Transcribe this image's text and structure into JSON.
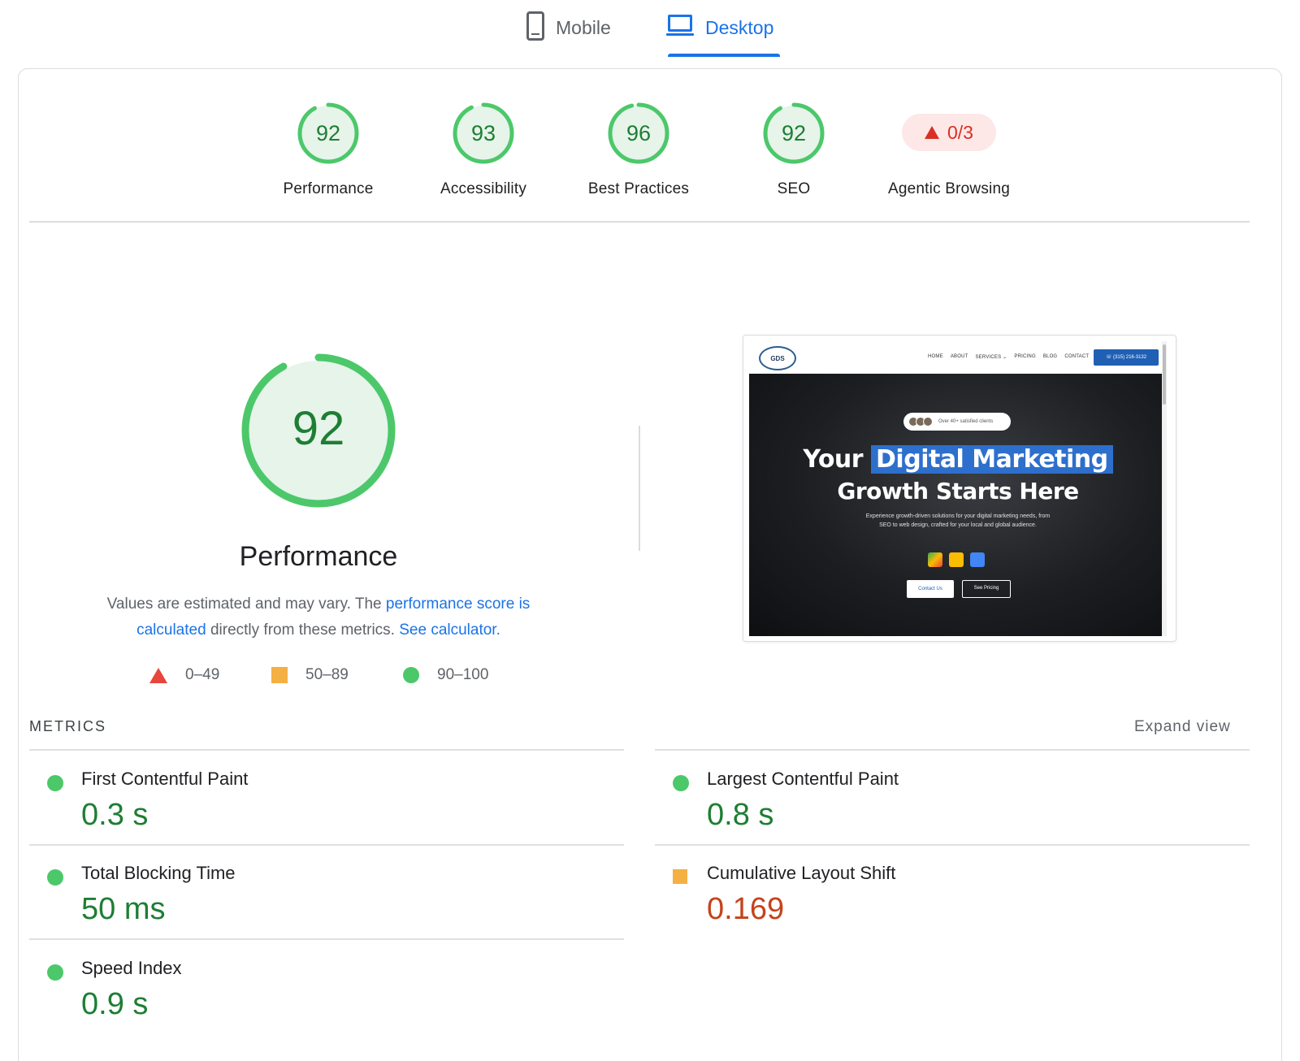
{
  "tabs": [
    {
      "label": "Mobile",
      "icon": "phone-icon",
      "active": false
    },
    {
      "label": "Desktop",
      "icon": "laptop-icon",
      "active": true
    }
  ],
  "categories": [
    {
      "score": "92",
      "label": "Performance"
    },
    {
      "score": "93",
      "label": "Accessibility"
    },
    {
      "score": "96",
      "label": "Best Practices"
    },
    {
      "score": "92",
      "label": "SEO"
    },
    {
      "score": "0/3",
      "label": "Agentic Browsing"
    }
  ],
  "performance": {
    "score": "92",
    "score_value": 92,
    "title": "Performance",
    "desc_part1": "Values are estimated and may vary. The ",
    "desc_link1": "performance score is calculated",
    "desc_part2": " directly from these metrics. ",
    "desc_link2": "See calculator."
  },
  "legend": [
    {
      "range": "0–49",
      "shape": "triangle",
      "color": "#e8453c"
    },
    {
      "range": "50–89",
      "shape": "square",
      "color": "#f4b042"
    },
    {
      "range": "90–100",
      "shape": "circle",
      "color": "#4cc86a"
    }
  ],
  "metrics_header": "METRICS",
  "expand_label": "Expand view",
  "metrics": [
    {
      "name": "First Contentful Paint",
      "value": "0.3 s",
      "status": "good"
    },
    {
      "name": "Largest Contentful Paint",
      "value": "0.8 s",
      "status": "good"
    },
    {
      "name": "Total Blocking Time",
      "value": "50 ms",
      "status": "good"
    },
    {
      "name": "Cumulative Layout Shift",
      "value": "0.169",
      "status": "average"
    },
    {
      "name": "Speed Index",
      "value": "0.9 s",
      "status": "good"
    }
  ],
  "screenshot": {
    "logo": "GDS",
    "nav": [
      "HOME",
      "ABOUT",
      "SERVICES ⌄",
      "PRICING",
      "BLOG",
      "CONTACT"
    ],
    "phone": "☏ (315) 216-3132",
    "pill": "Over 40+ satisfied clients",
    "headline_plain": "Your ",
    "headline_highlight": "Digital Marketing",
    "headline_line2": "Growth Starts Here",
    "subtext": "Experience growth-driven solutions for your digital marketing needs, from SEO to web design, crafted for your local and global audience.",
    "btn_contact": "Contact Us",
    "btn_pricing": "See Pricing"
  },
  "colors": {
    "pass": "#1e7e34",
    "pass_ring": "#4cc86a",
    "pass_bg": "#e6f4ea",
    "fail": "#d93025",
    "average": "#f4b042",
    "link": "#1a73e8"
  }
}
